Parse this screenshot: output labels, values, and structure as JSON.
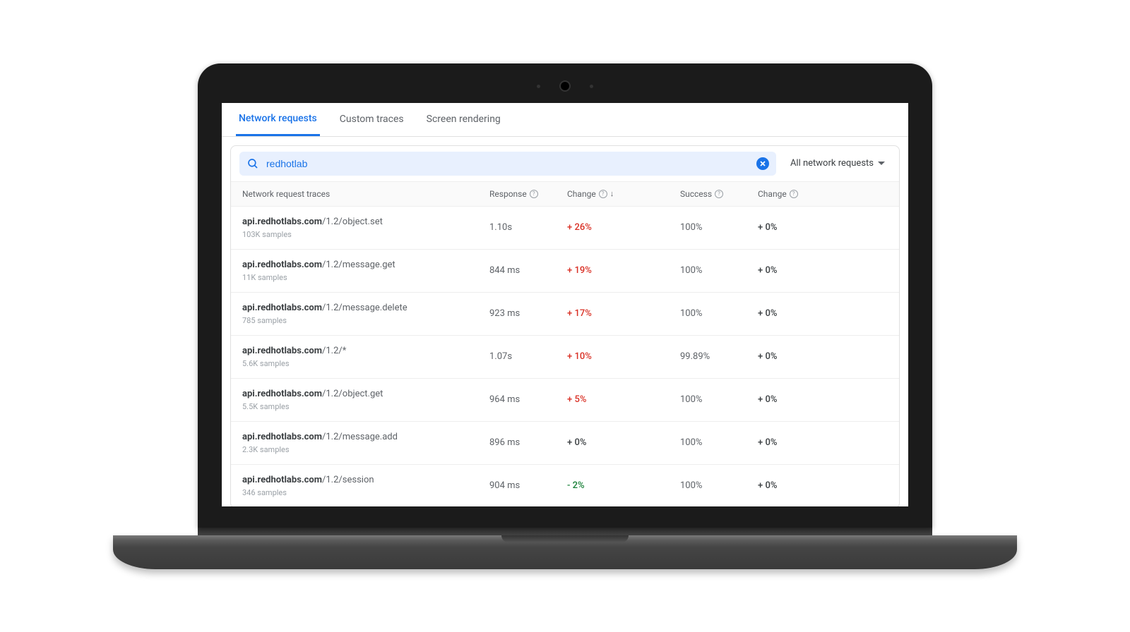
{
  "tabs": [
    {
      "label": "Network requests",
      "active": true
    },
    {
      "label": "Custom traces",
      "active": false
    },
    {
      "label": "Screen rendering",
      "active": false
    }
  ],
  "search": {
    "value": "redhotlab"
  },
  "filter": {
    "label": "All network requests"
  },
  "columns": {
    "trace": "Network request traces",
    "response": "Response",
    "change1": "Change",
    "success": "Success",
    "change2": "Change"
  },
  "rows": [
    {
      "host": "api.redhotlabs.com",
      "path": "/1.2/object.set",
      "samples": "103K samples",
      "response": "1.10s",
      "change1": "+ 26%",
      "change1_type": "pos",
      "success": "100%",
      "change2": "+ 0%"
    },
    {
      "host": "api.redhotlabs.com",
      "path": "/1.2/message.get",
      "samples": "11K samples",
      "response": "844 ms",
      "change1": "+ 19%",
      "change1_type": "pos",
      "success": "100%",
      "change2": "+ 0%"
    },
    {
      "host": "api.redhotlabs.com",
      "path": "/1.2/message.delete",
      "samples": "785 samples",
      "response": "923 ms",
      "change1": "+ 17%",
      "change1_type": "pos",
      "success": "100%",
      "change2": "+ 0%"
    },
    {
      "host": "api.redhotlabs.com",
      "path": "/1.2/*",
      "samples": "5.6K samples",
      "response": "1.07s",
      "change1": "+ 10%",
      "change1_type": "pos",
      "success": "99.89%",
      "change2": "+ 0%"
    },
    {
      "host": "api.redhotlabs.com",
      "path": "/1.2/object.get",
      "samples": "5.5K samples",
      "response": "964 ms",
      "change1": "+ 5%",
      "change1_type": "pos",
      "success": "100%",
      "change2": "+ 0%"
    },
    {
      "host": "api.redhotlabs.com",
      "path": "/1.2/message.add",
      "samples": "2.3K samples",
      "response": "896 ms",
      "change1": "+ 0%",
      "change1_type": "zero",
      "success": "100%",
      "change2": "+ 0%"
    },
    {
      "host": "api.redhotlabs.com",
      "path": "/1.2/session",
      "samples": "346 samples",
      "response": "904 ms",
      "change1": "- 2%",
      "change1_type": "neg",
      "success": "100%",
      "change2": "+ 0%"
    }
  ]
}
